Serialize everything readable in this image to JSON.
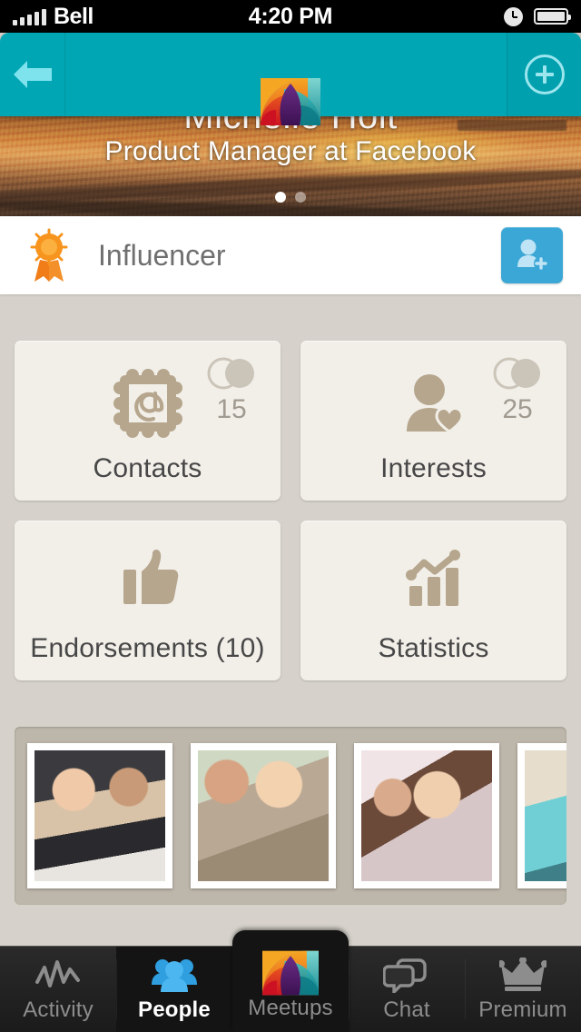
{
  "status_bar": {
    "carrier": "Bell",
    "time": "4:20 PM",
    "signal_icon": "signal-bars-icon",
    "clock_icon": "clock-icon",
    "battery_icon": "battery-icon"
  },
  "nav": {
    "back_icon": "back-arrow-icon",
    "logo_icon": "meetups-logo-icon",
    "add_icon": "plus-circle-icon"
  },
  "hero": {
    "name": "Michelle Holt",
    "subtitle": "Product Manager at Facebook",
    "dots": 2,
    "active_dot": 0
  },
  "influencer": {
    "badge_icon": "award-ribbon-icon",
    "label": "Influencer",
    "add_contact_icon": "add-person-icon",
    "add_contact_color": "#3ba7d6"
  },
  "cards": [
    {
      "label": "Contacts",
      "icon": "at-sign-frame-icon",
      "count": "15",
      "count_icon": "venn-diagram-icon",
      "has_count": true
    },
    {
      "label": "Interests",
      "icon": "person-heart-icon",
      "count": "25",
      "count_icon": "venn-diagram-icon",
      "has_count": true
    },
    {
      "label": "Endorsements (10)",
      "icon": "thumbs-up-icon",
      "count": "",
      "count_icon": "",
      "has_count": false
    },
    {
      "label": "Statistics",
      "icon": "bar-chart-trend-icon",
      "count": "",
      "count_icon": "",
      "has_count": false
    }
  ],
  "photo_strip": {
    "photos": [
      {
        "name": "photo-women-laptop-cafe"
      },
      {
        "name": "photo-couple-talking"
      },
      {
        "name": "photo-group-listening"
      },
      {
        "name": "photo-man-teal-shirt"
      }
    ]
  },
  "tabs": [
    {
      "label": "Activity",
      "icon": "activity-pulse-icon",
      "active": false
    },
    {
      "label": "People",
      "icon": "people-group-icon",
      "active": true
    },
    {
      "label": "Meetups",
      "icon": "meetups-logo-icon",
      "active": false,
      "center": true
    },
    {
      "label": "Chat",
      "icon": "chat-bubbles-icon",
      "active": false
    },
    {
      "label": "Premium",
      "icon": "crown-icon",
      "active": false
    }
  ],
  "colors": {
    "nav_teal": "#00a6b4",
    "accent_blue": "#3ba7d6",
    "background": "#d6d2cb",
    "card": "#f2efe9",
    "icon_tan": "#b6a68d",
    "tab_dark": "#1b1b1b"
  }
}
